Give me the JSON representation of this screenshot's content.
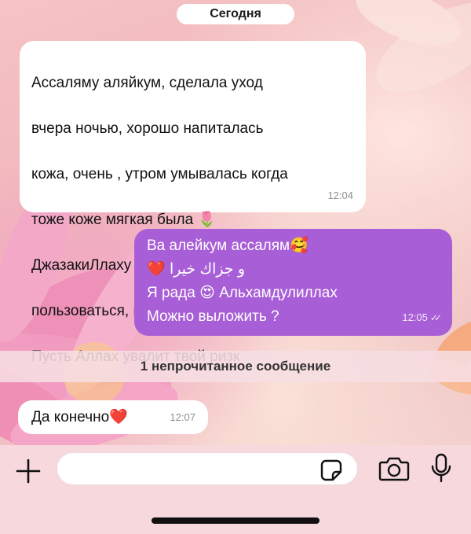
{
  "header": {
    "date_chip": "Сегодня"
  },
  "messages": [
    {
      "direction": "incoming",
      "lines": [
        "Ассаляму аляйкум, сделала уход",
        "вчера ночью, хорошо напиталась",
        "кожа, очень , утром умывалась когда",
        "тоже коже мягкая была 🌷",
        "ДжазакиЛлаху Хайран , дальше буду",
        "пользоваться, посмотрим как будет",
        "Пусть Аллах увалит твой ризк"
      ],
      "time": "12:04"
    },
    {
      "direction": "outgoing",
      "lines": [
        "Ва алейкум  ассалям🥰",
        "❤️ و جزاك خيرا",
        "Я рада 😍 Альхамдулиллах",
        "Можно выложить ?"
      ],
      "time": "12:05",
      "status": "read"
    },
    {
      "direction": "incoming",
      "text": "Да конечно❤️",
      "time": "12:07"
    }
  ],
  "unread_divider": "1 непрочитанное сообщение",
  "composer": {
    "placeholder": "",
    "icons": [
      "plus-icon",
      "sticker-icon",
      "camera-icon",
      "microphone-icon"
    ]
  },
  "colors": {
    "outgoing_bubble": "#a85ed6",
    "incoming_bubble": "#ffffff",
    "timestamp_gray": "#8e8e93"
  }
}
